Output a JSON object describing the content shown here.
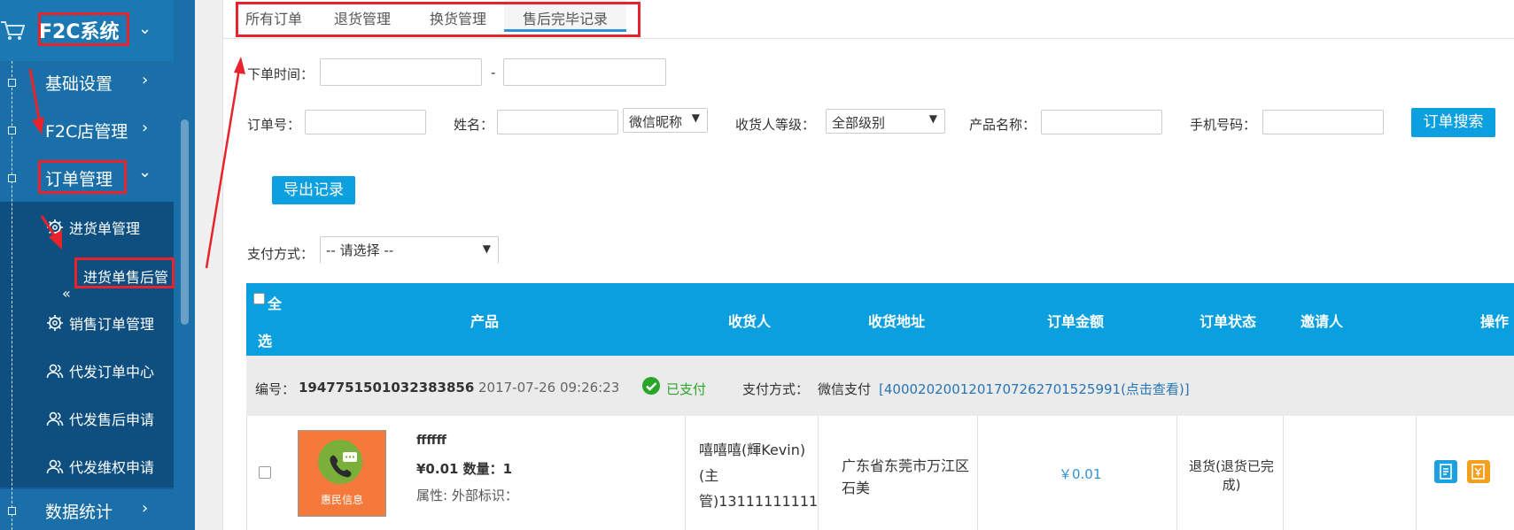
{
  "sidebar": {
    "brand": "F2C系统",
    "items": [
      {
        "label": "基础设置"
      },
      {
        "label": "F2C店管理"
      },
      {
        "label": "订单管理"
      },
      {
        "label": "数据统计"
      }
    ],
    "subitems": [
      {
        "label": "进货单管理",
        "icon": "gear-icon"
      },
      {
        "label": "进货单售后管",
        "icon": ""
      },
      {
        "label": "销售订单管理",
        "icon": "gear-icon"
      },
      {
        "label": "代发订单中心",
        "icon": "users-icon"
      },
      {
        "label": "代发售后申请",
        "icon": "users-icon"
      },
      {
        "label": "代发维权申请",
        "icon": "users-icon"
      }
    ],
    "double_chevron": "«"
  },
  "tabs": [
    {
      "label": "所有订单"
    },
    {
      "label": "退货管理"
    },
    {
      "label": "换货管理"
    },
    {
      "label": "售后完毕记录",
      "active": true
    }
  ],
  "filters": {
    "order_time_label": "下单时间：",
    "range_sep": "-",
    "order_no_label": "订单号：",
    "name_label": "姓名：",
    "name_type_select": "微信昵称",
    "receiver_level_label": "收货人等级：",
    "receiver_level_select": "全部级别",
    "product_name_label": "产品名称：",
    "phone_label": "手机号码：",
    "search_button": "订单搜索",
    "export_button": "导出记录",
    "pay_method_label": "支付方式：",
    "pay_method_select": "-- 请选择 --"
  },
  "table": {
    "headers": {
      "select_all_1": "全",
      "select_all_2": "选",
      "product": "产品",
      "receiver": "收货人",
      "address": "收货地址",
      "amount": "订单金额",
      "status": "订单状态",
      "inviter": "邀请人",
      "actions": "操作"
    },
    "order": {
      "number_label": "编号：",
      "number": "1947751501032383856",
      "time": "2017-07-26 09:26:23",
      "paid_status": "已支付",
      "pay_method_label": "支付方式：",
      "pay_method": "微信支付",
      "transaction": "[4000202001201707262701525991(点击查看)]",
      "product_name": "ffffff",
      "price_qty": "¥0.01 数量：1",
      "attrs": "属性: 外部标识：",
      "image_caption": "惠民信息",
      "receiver_line1": "嘻嘻嘻(輝Kevin)",
      "receiver_line2": "(主",
      "receiver_line3": "管)13111111111",
      "address_line1": "广东省东莞市万江区",
      "address_line2": "石美",
      "amount": "￥0.01",
      "status_line1": "退货(退货已完",
      "status_line2": "成)"
    }
  },
  "colors": {
    "accent": "#0aa0e0",
    "sidebar": "#1a6fa8",
    "annotation": "#e8232b",
    "paid": "#2aa52a"
  }
}
